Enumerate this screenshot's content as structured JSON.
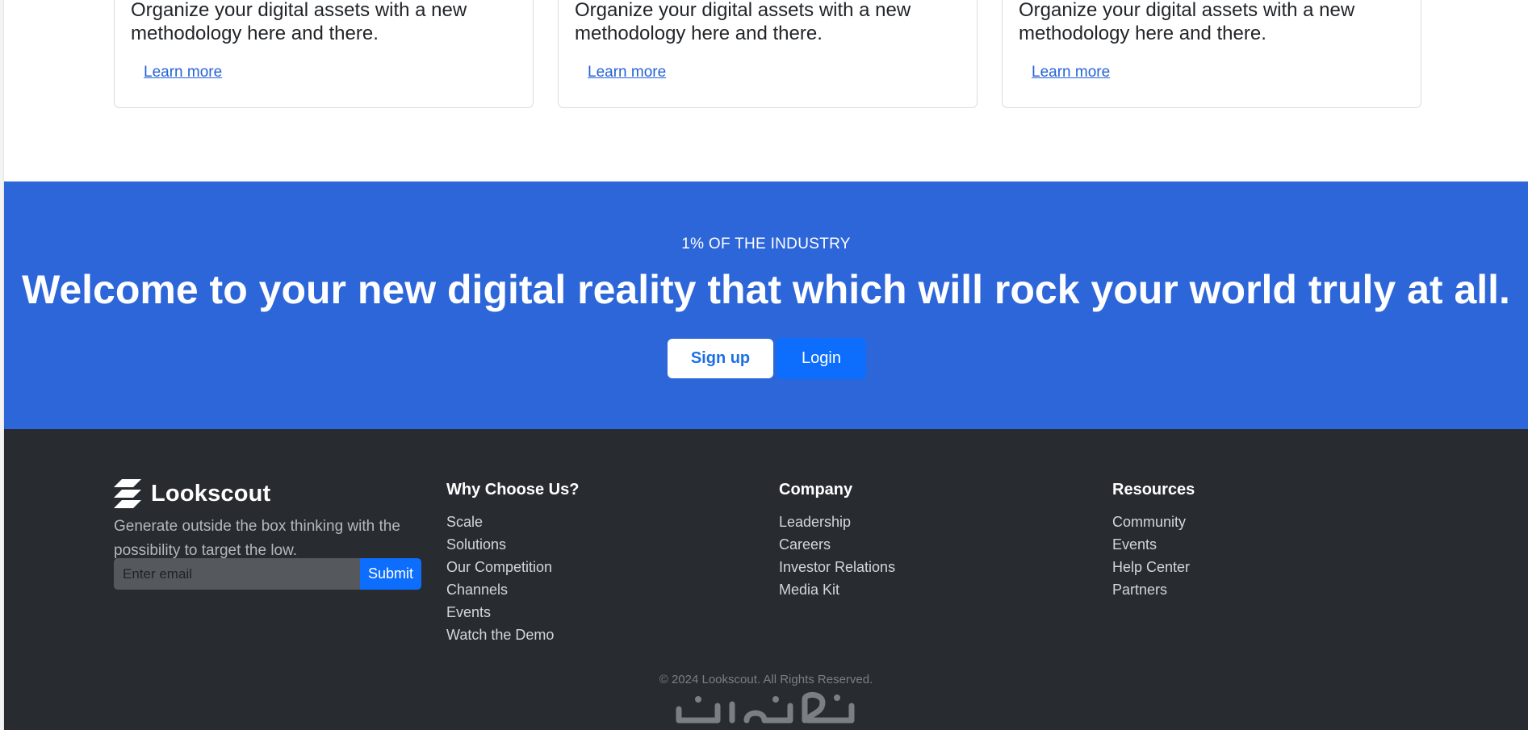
{
  "cards": [
    {
      "text": "Organize your digital assets with a new methodology here and there.",
      "link": "Learn more"
    },
    {
      "text": "Organize your digital assets with a new methodology here and there.",
      "link": "Learn more"
    },
    {
      "text": "Organize your digital assets with a new methodology here and there.",
      "link": "Learn more"
    }
  ],
  "cta": {
    "eyebrow": "1% OF THE INDUSTRY",
    "headline": "Welcome to your new digital reality that which will rock your world truly at all.",
    "signup_label": "Sign up",
    "login_label": "Login",
    "background": "#2d66d9"
  },
  "footer": {
    "brand_name": "Lookscout",
    "brand_desc": "Generate outside the box thinking with the possibility to target the low.",
    "email_placeholder": "Enter email",
    "submit_label": "Submit",
    "columns": [
      {
        "title": "Why Choose Us?",
        "items": [
          "Scale",
          "Solutions",
          "Our Competition",
          "Channels",
          "Events",
          "Watch the Demo"
        ]
      },
      {
        "title": "Company",
        "items": [
          "Leadership",
          "Careers",
          "Investor Relations",
          "Media Kit"
        ]
      },
      {
        "title": "Resources",
        "items": [
          "Community",
          "Events",
          "Help Center",
          "Partners"
        ]
      }
    ],
    "copyright": "© 2024 Lookscout. All Rights Reserved.",
    "background": "#282c31"
  },
  "colors": {
    "accent": "#0d6efd",
    "link": "#2563d6"
  }
}
